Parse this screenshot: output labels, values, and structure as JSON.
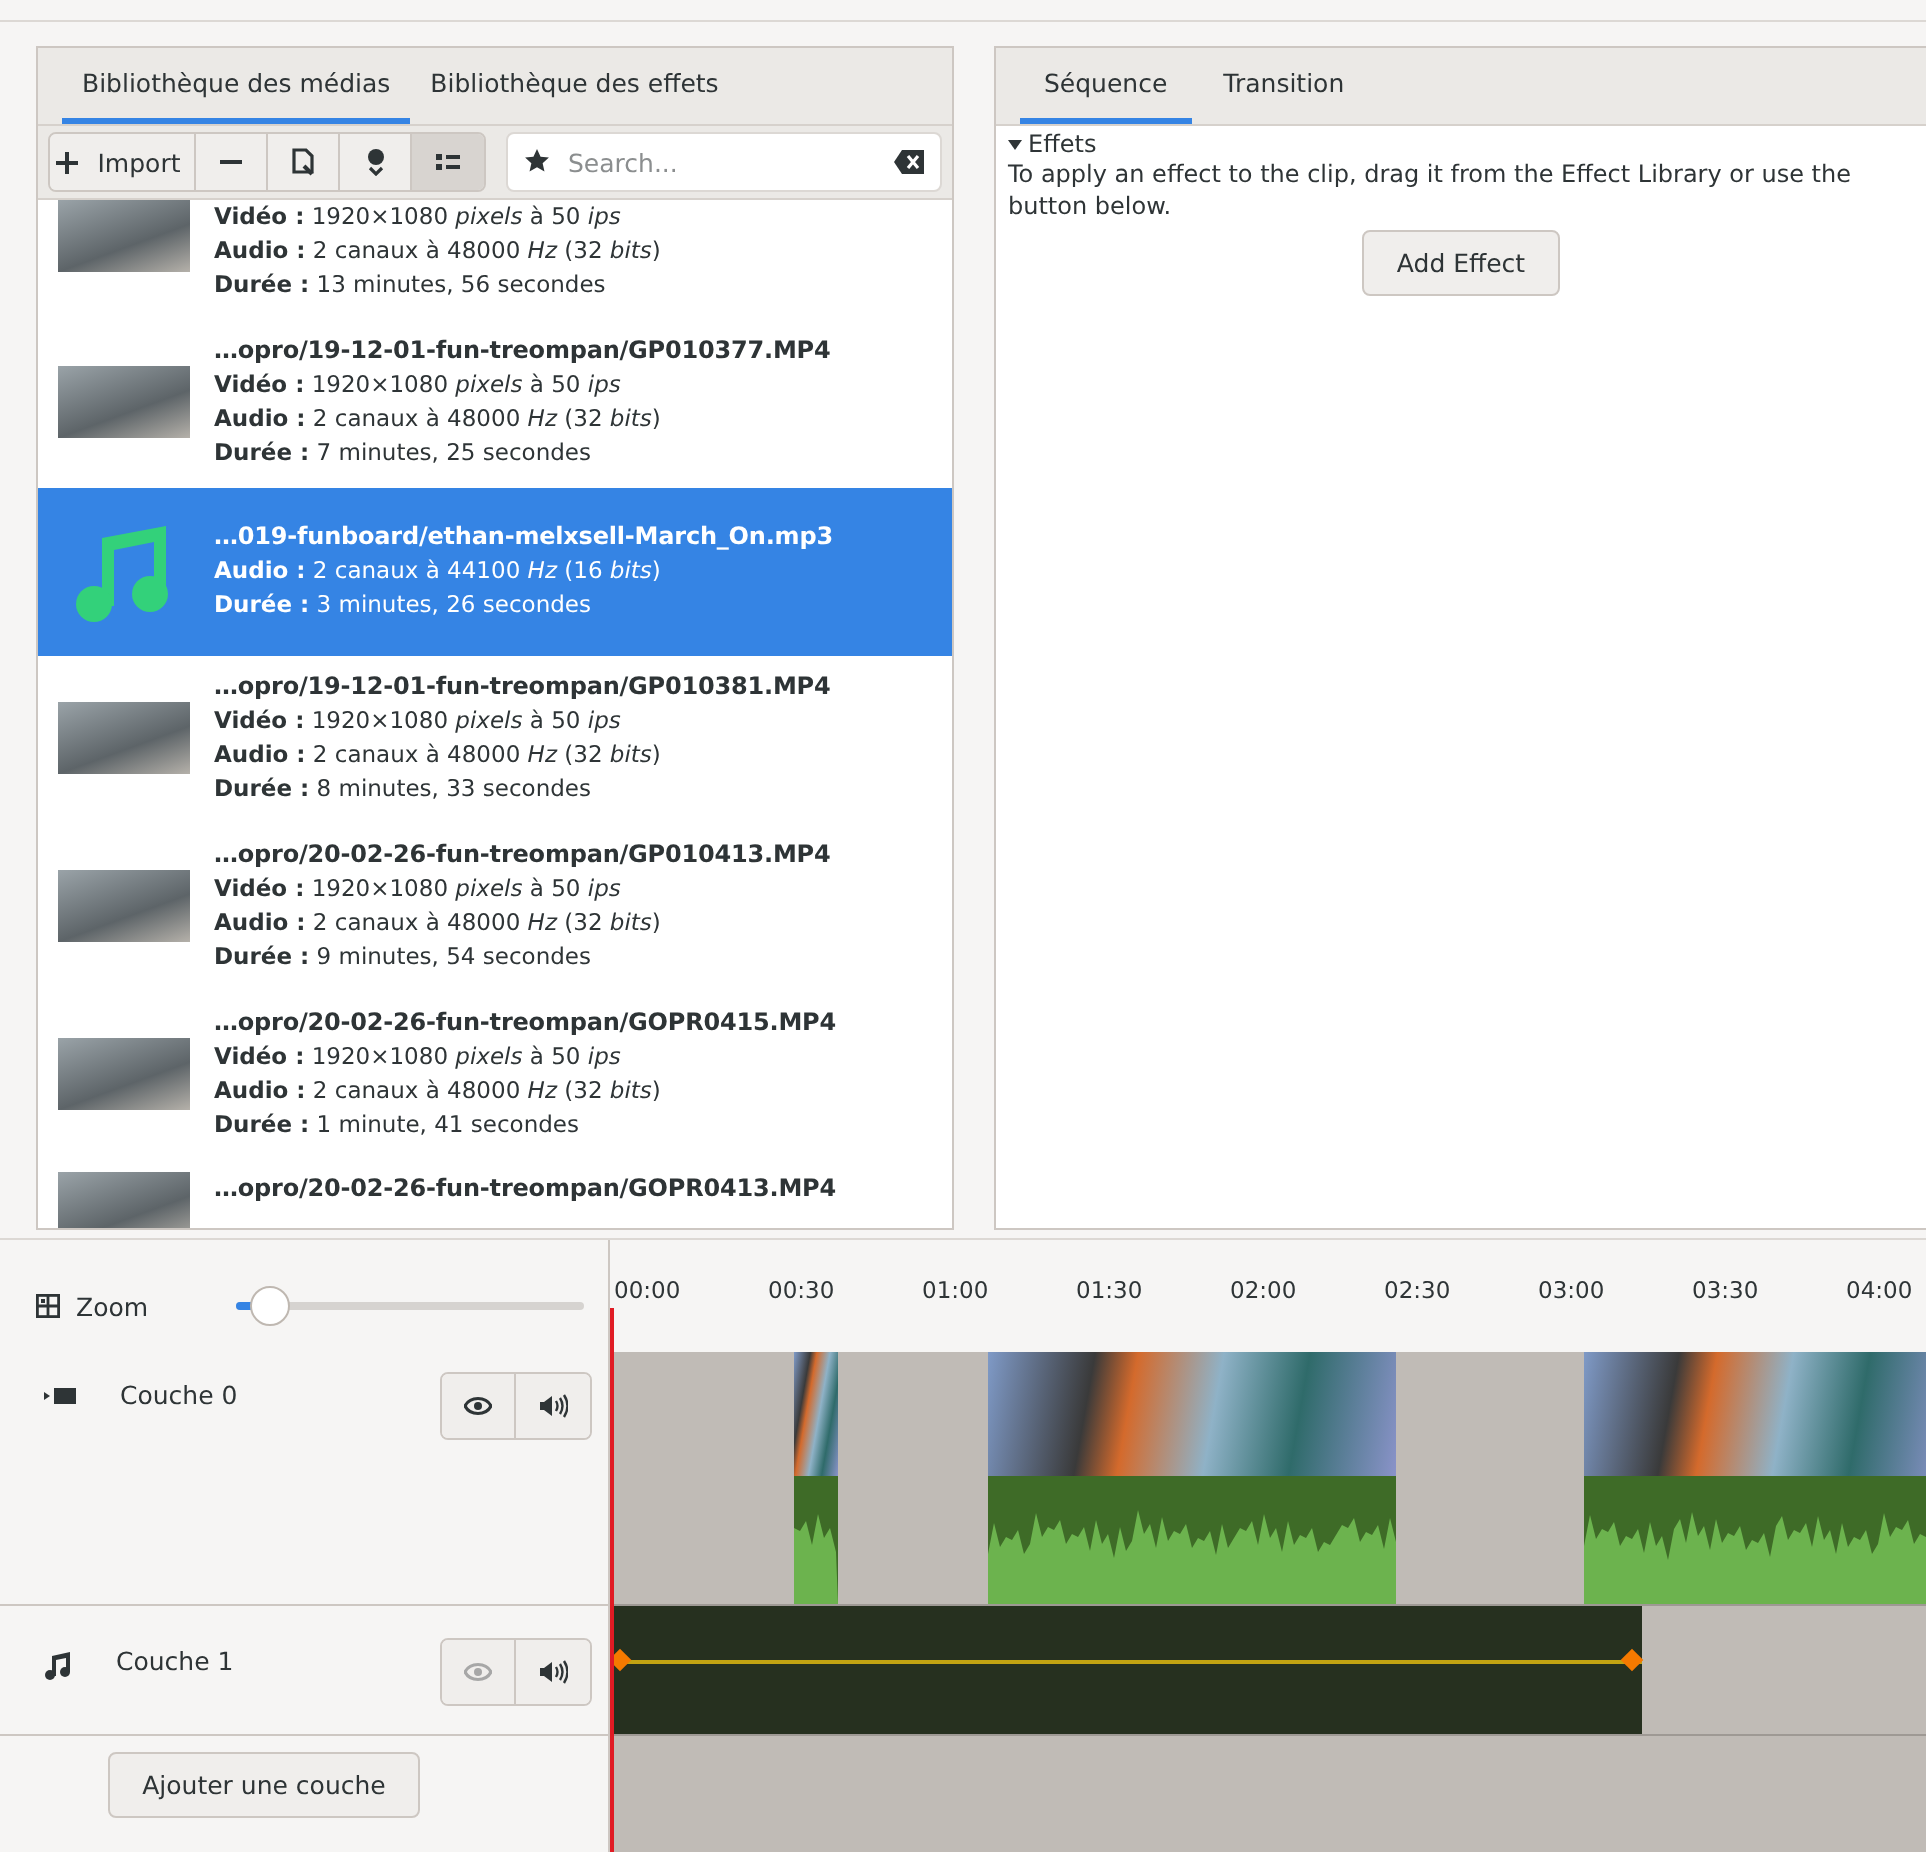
{
  "media_library": {
    "tabs": [
      {
        "label": "Bibliothèque des médias",
        "selected": true
      },
      {
        "label": "Bibliothèque des effets",
        "selected": false
      }
    ],
    "toolbar": {
      "import_button": "Import",
      "list_view": {
        "selected": true
      },
      "search": {
        "placeholder": "Search..."
      }
    },
    "items": [
      {
        "kind": "video",
        "selected": false,
        "details": [
          "**Vidéo :** 1920×1080 *pixels* à 50 *ips*",
          "**Audio :** 2 canaux à 48000 *Hz* (32 *bits*)",
          "**Durée :** 13 minutes, 56 secondes"
        ]
      },
      {
        "kind": "video",
        "selected": false,
        "title": "…opro/19-12-01-fun-treompan/GP010377.MP4",
        "details": [
          "**Vidéo :** 1920×1080 *pixels* à 50 *ips*",
          "**Audio :** 2 canaux à 48000 *Hz* (32 *bits*)",
          "**Durée :** 7 minutes, 25 secondes"
        ]
      },
      {
        "kind": "audio",
        "selected": true,
        "title": "…019-funboard/ethan-melxsell-March_On.mp3",
        "details": [
          "**Audio :** 2 canaux à 44100 *Hz* (16 *bits*)",
          "**Durée :** 3 minutes, 26 secondes"
        ]
      },
      {
        "kind": "video",
        "selected": false,
        "title": "…opro/19-12-01-fun-treompan/GP010381.MP4",
        "details": [
          "**Vidéo :** 1920×1080 *pixels* à 50 *ips*",
          "**Audio :** 2 canaux à 48000 *Hz* (32 *bits*)",
          "**Durée :** 8 minutes, 33 secondes"
        ]
      },
      {
        "kind": "video",
        "selected": false,
        "title": "…opro/20-02-26-fun-treompan/GP010413.MP4",
        "details": [
          "**Vidéo :** 1920×1080 *pixels* à 50 *ips*",
          "**Audio :** 2 canaux à 48000 *Hz* (32 *bits*)",
          "**Durée :** 9 minutes, 54 secondes"
        ]
      },
      {
        "kind": "video",
        "selected": false,
        "title": "…opro/20-02-26-fun-treompan/GOPR0415.MP4",
        "details": [
          "**Vidéo :** 1920×1080 *pixels* à 50 *ips*",
          "**Audio :** 2 canaux à 48000 *Hz* (32 *bits*)",
          "**Durée :** 1 minute, 41 secondes"
        ]
      },
      {
        "kind": "video",
        "selected": false,
        "title": "…opro/20-02-26-fun-treompan/GOPR0413.MP4"
      }
    ]
  },
  "clip_panel": {
    "tabs": [
      {
        "label": "Séquence",
        "selected": true
      },
      {
        "label": "Transition",
        "selected": false
      }
    ],
    "section": {
      "label": "Effets",
      "expanded": true
    },
    "hint": "To apply an effect to the clip, drag it from the Effect Library or use the button below.",
    "add_button": "Add Effect"
  },
  "timeline": {
    "zoom_label": "Zoom",
    "zoom": {
      "level": 0.1
    },
    "ruler": [
      "00:00",
      "00:30",
      "01:00",
      "01:30",
      "02:00",
      "02:30",
      "03:00",
      "03:30",
      "04:00"
    ],
    "layers": [
      {
        "name": "Couche 0",
        "kind": "video",
        "visible": true
      },
      {
        "name": "Couche 1",
        "kind": "audio",
        "visible": false
      }
    ],
    "add_layer_button": "Ajouter une couche"
  }
}
